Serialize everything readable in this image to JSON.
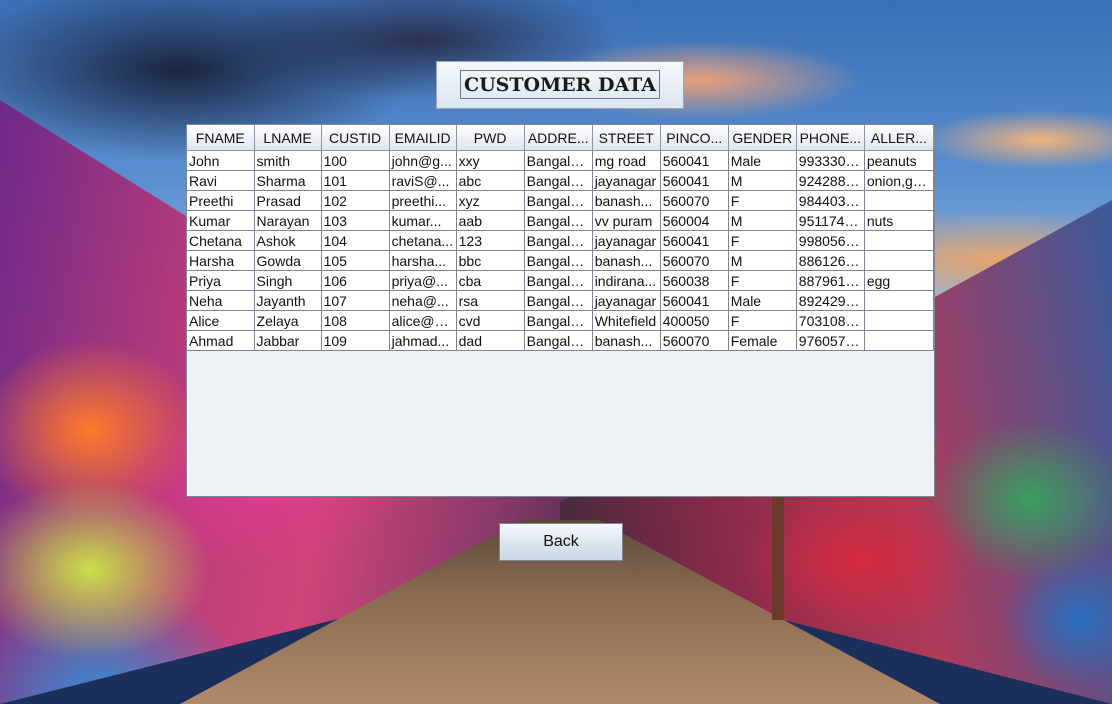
{
  "title": "CUSTOMER DATA",
  "table": {
    "columns": [
      "FNAME",
      "LNAME",
      "CUSTID",
      "EMAILID",
      "PWD",
      "ADDRE...",
      "STREET",
      "PINCO...",
      "GENDER",
      "PHONE...",
      "ALLER..."
    ],
    "rows": [
      [
        "John",
        "smith",
        "100",
        "john@g...",
        "xxy",
        "Bangalo...",
        "mg road",
        "560041",
        "Male",
        "9933300...",
        "peanuts"
      ],
      [
        "Ravi",
        "Sharma",
        "101",
        "raviS@...",
        "abc",
        "Bangalo...",
        "jayanagar",
        "560041",
        "M",
        "9242889...",
        "onion,ga..."
      ],
      [
        "Preethi",
        "Prasad",
        "102",
        "preethi...",
        "xyz",
        "Bangalo...",
        "banash...",
        "560070",
        "F",
        "9844037...",
        ""
      ],
      [
        "Kumar",
        "Narayan",
        "103",
        "kumar...",
        "aab",
        "Bangalo...",
        "vv puram",
        "560004",
        "M",
        "9511747...",
        "nuts"
      ],
      [
        "Chetana",
        "Ashok",
        "104",
        "chetana...",
        "123",
        "Bangalo...",
        "jayanagar",
        "560041",
        "F",
        "9980564...",
        ""
      ],
      [
        "Harsha",
        "Gowda",
        "105",
        "harsha...",
        "bbc",
        "Bangalo...",
        "banash...",
        "560070",
        "M",
        "8861268...",
        ""
      ],
      [
        "Priya",
        "Singh",
        "106",
        "priya@...",
        "cba",
        "Bangalo...",
        "indirana...",
        "560038",
        "F",
        "8879610...",
        "egg"
      ],
      [
        "Neha",
        "Jayanth",
        "107",
        "neha@...",
        "rsa",
        "Bangalo...",
        "jayanagar",
        "560041",
        "Male",
        "8924299...",
        ""
      ],
      [
        "Alice",
        "Zelaya",
        "108",
        "alice@g...",
        "cvd",
        "Bangalo...",
        "Whitefield",
        "400050",
        "F",
        "7031086...",
        ""
      ],
      [
        "Ahmad",
        "Jabbar",
        "109",
        "jahmad...",
        "dad",
        "Bangalo...",
        "banash...",
        "560070",
        "Female",
        "9760578...",
        ""
      ]
    ]
  },
  "back_button": {
    "label": "Back"
  }
}
